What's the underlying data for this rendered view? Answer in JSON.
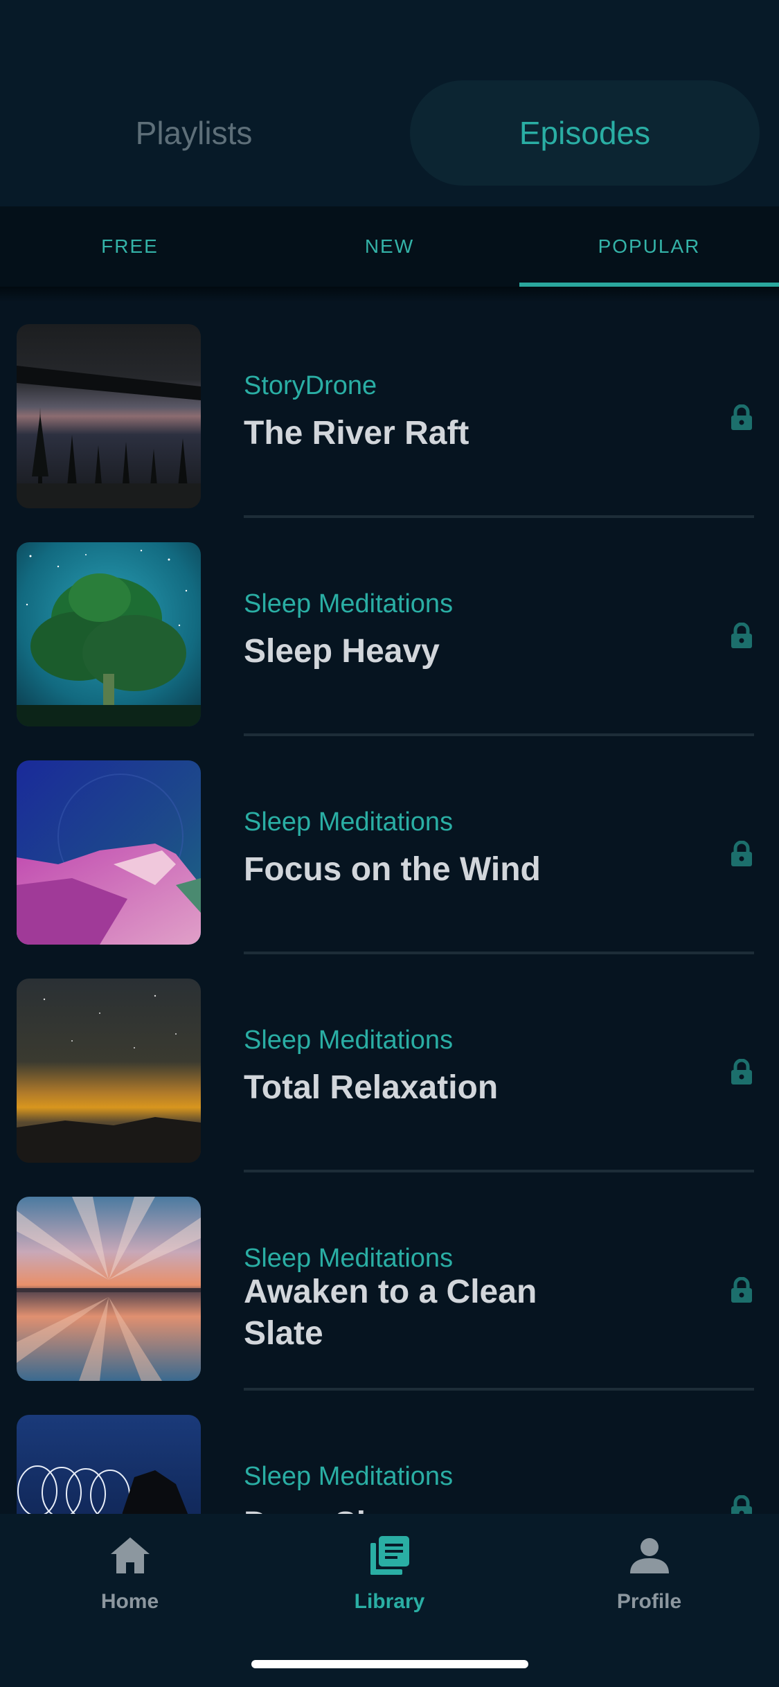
{
  "segmented": {
    "playlists_label": "Playlists",
    "episodes_label": "Episodes",
    "selected": "Episodes"
  },
  "tabs": [
    {
      "label": "FREE"
    },
    {
      "label": "NEW"
    },
    {
      "label": "POPULAR"
    }
  ],
  "selected_tab": "POPULAR",
  "episodes": [
    {
      "show": "StoryDrone",
      "title": "The River Raft",
      "locked": true
    },
    {
      "show": "Sleep Meditations",
      "title": "Sleep Heavy",
      "locked": true
    },
    {
      "show": "Sleep Meditations",
      "title": "Focus on the Wind",
      "locked": true
    },
    {
      "show": "Sleep Meditations",
      "title": "Total Relaxation",
      "locked": true
    },
    {
      "show": "Sleep Meditations",
      "title": "Awaken to a Clean Slate",
      "locked": true
    },
    {
      "show": "Sleep Meditations",
      "title": "Deep Sleep",
      "locked": true
    }
  ],
  "bottom_nav": [
    {
      "label": "Home",
      "icon": "home-icon"
    },
    {
      "label": "Library",
      "icon": "library-icon"
    },
    {
      "label": "Profile",
      "icon": "profile-icon"
    }
  ],
  "colors": {
    "accent": "#2aaea4",
    "background": "#061420",
    "title_text": "#d2d6db",
    "inactive": "#8c979f"
  }
}
